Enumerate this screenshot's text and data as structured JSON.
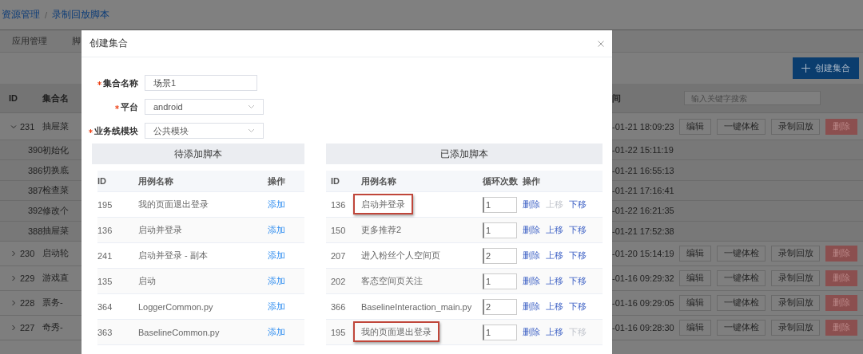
{
  "breadcrumb": {
    "items": [
      "资源管理",
      "录制回放脚本"
    ],
    "separator": "/"
  },
  "tabs": [
    {
      "label": "应用管理",
      "selected": false
    },
    {
      "label": "脚",
      "selected": false
    }
  ],
  "create_button": {
    "label": "创建集合"
  },
  "table": {
    "columns": [
      "ID",
      "集合名"
    ],
    "time_column": "间",
    "search": {
      "placeholder": "输入关键字搜索"
    },
    "rows": [
      {
        "id": "231",
        "name": "抽屉菜",
        "time": "-01-21 18:09:23",
        "expanded": true,
        "actions": [
          {
            "label": "编辑",
            "kind": "default"
          },
          {
            "label": "一键体检",
            "kind": "default"
          },
          {
            "label": "录制回放",
            "kind": "default"
          },
          {
            "label": "删除",
            "kind": "danger"
          }
        ],
        "children": [
          {
            "id": "390",
            "name": "初始化",
            "time": "-01-22 15:11:19"
          },
          {
            "id": "386",
            "name": "切换底",
            "time": "-01-21 16:55:13"
          },
          {
            "id": "387",
            "name": "检查菜",
            "time": "-01-21 17:16:41"
          },
          {
            "id": "392",
            "name": "修改个",
            "time": "-01-22 16:21:35"
          },
          {
            "id": "388",
            "name": "抽屉菜",
            "time": "-01-21 17:52:38"
          }
        ]
      },
      {
        "id": "230",
        "name": "启动轮",
        "time": "-01-20 15:14:19",
        "expanded": false,
        "actions": [
          {
            "label": "编辑",
            "kind": "default"
          },
          {
            "label": "一键体检",
            "kind": "default"
          },
          {
            "label": "录制回放",
            "kind": "default"
          },
          {
            "label": "删除",
            "kind": "danger"
          }
        ]
      },
      {
        "id": "229",
        "name": "游戏直",
        "time": "-01-16 09:29:32",
        "expanded": false,
        "actions": [
          {
            "label": "编辑",
            "kind": "default"
          },
          {
            "label": "一键体检",
            "kind": "default"
          },
          {
            "label": "录制回放",
            "kind": "default"
          },
          {
            "label": "删除",
            "kind": "danger"
          }
        ]
      },
      {
        "id": "228",
        "name": "票务-",
        "time": "-01-16 09:29:05",
        "expanded": false,
        "actions": [
          {
            "label": "编辑",
            "kind": "default"
          },
          {
            "label": "一键体检",
            "kind": "default"
          },
          {
            "label": "录制回放",
            "kind": "default"
          },
          {
            "label": "删除",
            "kind": "danger"
          }
        ]
      },
      {
        "id": "227",
        "name": "奇秀-",
        "time": "-01-16 09:28:30",
        "expanded": false,
        "actions": [
          {
            "label": "编辑",
            "kind": "default"
          },
          {
            "label": "一键体检",
            "kind": "default"
          },
          {
            "label": "录制回放",
            "kind": "default"
          },
          {
            "label": "删除",
            "kind": "danger"
          }
        ]
      }
    ]
  },
  "modal": {
    "title": "创建集合",
    "fields": [
      {
        "label": "集合名称",
        "required": true,
        "kind": "text",
        "value": "场景1"
      },
      {
        "label": "平台",
        "required": true,
        "kind": "select",
        "value": "android"
      },
      {
        "label": "业务线模块",
        "required": true,
        "kind": "select",
        "value": "公共模块"
      }
    ],
    "available": {
      "title": "待添加脚本",
      "columns": [
        "ID",
        "用例名称",
        "操作"
      ],
      "rows": [
        {
          "id": "195",
          "name": "我的页面退出登录",
          "action": "添加"
        },
        {
          "id": "136",
          "name": "启动并登录",
          "action": "添加"
        },
        {
          "id": "241",
          "name": "启动并登录 - 副本",
          "action": "添加"
        },
        {
          "id": "135",
          "name": "启动",
          "action": "添加"
        },
        {
          "id": "364",
          "name": "LoggerCommon.py",
          "action": "添加"
        },
        {
          "id": "363",
          "name": "BaselineCommon.py",
          "action": "添加"
        }
      ]
    },
    "added": {
      "title": "已添加脚本",
      "columns": [
        "ID",
        "用例名称",
        "循环次数",
        "操作"
      ],
      "rows": [
        {
          "id": "136",
          "name": "启动并登录",
          "count": "1",
          "highlighted": true,
          "actions": [
            {
              "label": "删除",
              "disabled": false
            },
            {
              "label": "上移",
              "disabled": true
            },
            {
              "label": "下移",
              "disabled": false
            }
          ]
        },
        {
          "id": "150",
          "name": "更多推荐2",
          "count": "1",
          "highlighted": false,
          "actions": [
            {
              "label": "删除",
              "disabled": false
            },
            {
              "label": "上移",
              "disabled": false
            },
            {
              "label": "下移",
              "disabled": false
            }
          ]
        },
        {
          "id": "207",
          "name": "进入粉丝个人空间页",
          "count": "2",
          "highlighted": false,
          "actions": [
            {
              "label": "删除",
              "disabled": false
            },
            {
              "label": "上移",
              "disabled": false
            },
            {
              "label": "下移",
              "disabled": false
            }
          ]
        },
        {
          "id": "202",
          "name": "客态空间页关注",
          "count": "1",
          "highlighted": false,
          "actions": [
            {
              "label": "删除",
              "disabled": false
            },
            {
              "label": "上移",
              "disabled": false
            },
            {
              "label": "下移",
              "disabled": false
            }
          ]
        },
        {
          "id": "366",
          "name": "BaselineInteraction_main.py",
          "count": "2",
          "highlighted": false,
          "actions": [
            {
              "label": "删除",
              "disabled": false
            },
            {
              "label": "上移",
              "disabled": false
            },
            {
              "label": "下移",
              "disabled": false
            }
          ]
        },
        {
          "id": "195",
          "name": "我的页面退出登录",
          "count": "1",
          "highlighted": true,
          "actions": [
            {
              "label": "删除",
              "disabled": false
            },
            {
              "label": "上移",
              "disabled": false
            },
            {
              "label": "下移",
              "disabled": true
            }
          ]
        }
      ]
    }
  }
}
